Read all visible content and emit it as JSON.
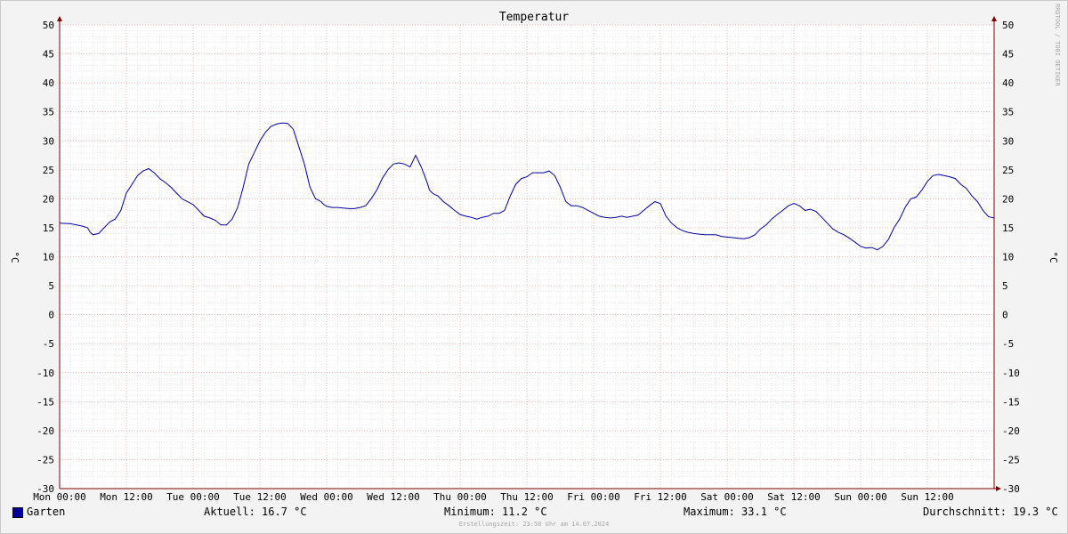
{
  "chart_data": {
    "type": "line",
    "title": "Temperatur",
    "ylabel": "°C",
    "ylim": [
      -30,
      50
    ],
    "y_ticks": [
      "50",
      "45",
      "40",
      "35",
      "30",
      "25",
      "20",
      "15",
      "10",
      "5",
      "0",
      "-5",
      "-10",
      "-15",
      "-20",
      "-25",
      "-30"
    ],
    "x_ticks": [
      "Mon 00:00",
      "Mon 12:00",
      "Tue 00:00",
      "Tue 12:00",
      "Wed 00:00",
      "Wed 12:00",
      "Thu 00:00",
      "Thu 12:00",
      "Fri 00:00",
      "Fri 12:00",
      "Sat 00:00",
      "Sat 12:00",
      "Sun 00:00",
      "Sun 12:00"
    ],
    "xlim_hours": [
      0,
      168
    ],
    "grid": true,
    "series": [
      {
        "name": "Garten",
        "color": "#0000a0",
        "x_hours": [
          0,
          2,
          4,
          5,
          5.5,
          6,
          7,
          8,
          9,
          10,
          11,
          12,
          13,
          14,
          15,
          16,
          17,
          18,
          19,
          20,
          21,
          22,
          23,
          24,
          25,
          26,
          27,
          28,
          29,
          30,
          31,
          32,
          33,
          34,
          35,
          36,
          37,
          38,
          39,
          40,
          41,
          42,
          43,
          44,
          45,
          46,
          46.5,
          47,
          47.5,
          48,
          49,
          50,
          51,
          52,
          53,
          54,
          55,
          56,
          57,
          58,
          59,
          60,
          61,
          62,
          63,
          64,
          65,
          66,
          66.5,
          67,
          67.5,
          68,
          69,
          70,
          71,
          72,
          73,
          74,
          75,
          76,
          77,
          78,
          79,
          80,
          81,
          82,
          83,
          84,
          85,
          86,
          87,
          88,
          89,
          90,
          91,
          92,
          93,
          94,
          95,
          96,
          97,
          98,
          99,
          100,
          101,
          102,
          103,
          104,
          105,
          106,
          107,
          108,
          109,
          110,
          111,
          112,
          113,
          114,
          115,
          116,
          117,
          118,
          119,
          120,
          121,
          122,
          123,
          124,
          125,
          126,
          127,
          128,
          129,
          130,
          131,
          132,
          133,
          134,
          135,
          136,
          137,
          138,
          139,
          140,
          141,
          142,
          143,
          144,
          145,
          146,
          147,
          148,
          149,
          150,
          151,
          152,
          153,
          154,
          155,
          156,
          157,
          158,
          159,
          160,
          161,
          162,
          163,
          164,
          165,
          166,
          167,
          168
        ],
        "values": [
          15.8,
          15.7,
          15.3,
          15.0,
          14.2,
          13.8,
          14.0,
          15.0,
          16.0,
          16.5,
          18.0,
          21.0,
          22.5,
          24.0,
          24.8,
          25.2,
          24.5,
          23.5,
          22.8,
          22.0,
          21.0,
          20.0,
          19.5,
          19.0,
          18.0,
          17.0,
          16.7,
          16.3,
          15.5,
          15.5,
          16.5,
          18.5,
          22.0,
          26.0,
          28.0,
          30.0,
          31.5,
          32.5,
          32.9,
          33.1,
          33.0,
          32.0,
          29.0,
          26.0,
          22.0,
          20.0,
          19.8,
          19.5,
          19.0,
          18.7,
          18.5,
          18.5,
          18.4,
          18.3,
          18.3,
          18.5,
          18.8,
          20.0,
          21.5,
          23.5,
          25.0,
          26.0,
          26.2,
          26.0,
          25.5,
          27.5,
          25.5,
          23.0,
          21.5,
          21.0,
          20.7,
          20.5,
          19.5,
          18.8,
          18.0,
          17.3,
          17.0,
          16.8,
          16.5,
          16.8,
          17.0,
          17.5,
          17.5,
          18.0,
          20.5,
          22.5,
          23.5,
          23.8,
          24.5,
          24.5,
          24.5,
          24.8,
          24.0,
          22.0,
          19.5,
          18.8,
          18.8,
          18.5,
          18.0,
          17.5,
          17.0,
          16.8,
          16.7,
          16.8,
          17.0,
          16.8,
          17.0,
          17.2,
          18.0,
          18.8,
          19.5,
          19.2,
          17.0,
          15.8,
          15.0,
          14.5,
          14.2,
          14.0,
          13.9,
          13.8,
          13.8,
          13.8,
          13.5,
          13.4,
          13.3,
          13.2,
          13.1,
          13.3,
          13.8,
          14.8,
          15.5,
          16.5,
          17.3,
          18.0,
          18.8,
          19.2,
          18.8,
          18.0,
          18.2,
          17.8,
          16.8,
          15.8,
          14.8,
          14.2,
          13.8,
          13.2,
          12.5,
          11.8,
          11.5,
          11.6,
          11.2,
          11.8,
          13.0,
          15.0,
          16.5,
          18.5,
          20.0,
          20.3,
          21.5,
          23.0,
          24.0,
          24.2,
          24.0,
          23.8,
          23.5,
          22.5,
          21.8,
          20.5,
          19.5,
          18.0,
          16.9,
          16.7
        ]
      }
    ]
  },
  "legend": {
    "series_label": "Garten",
    "current": "Aktuell: 16.7 °C",
    "minimum": "Minimum: 11.2 °C",
    "maximum": "Maximum: 33.1 °C",
    "average": "Durchschnitt: 19.3 °C"
  },
  "watermark": "RRDTOOL / TOBI OETIKER",
  "footer": "Erstellungszeit: 23:58 Uhr am 14.07.2024"
}
